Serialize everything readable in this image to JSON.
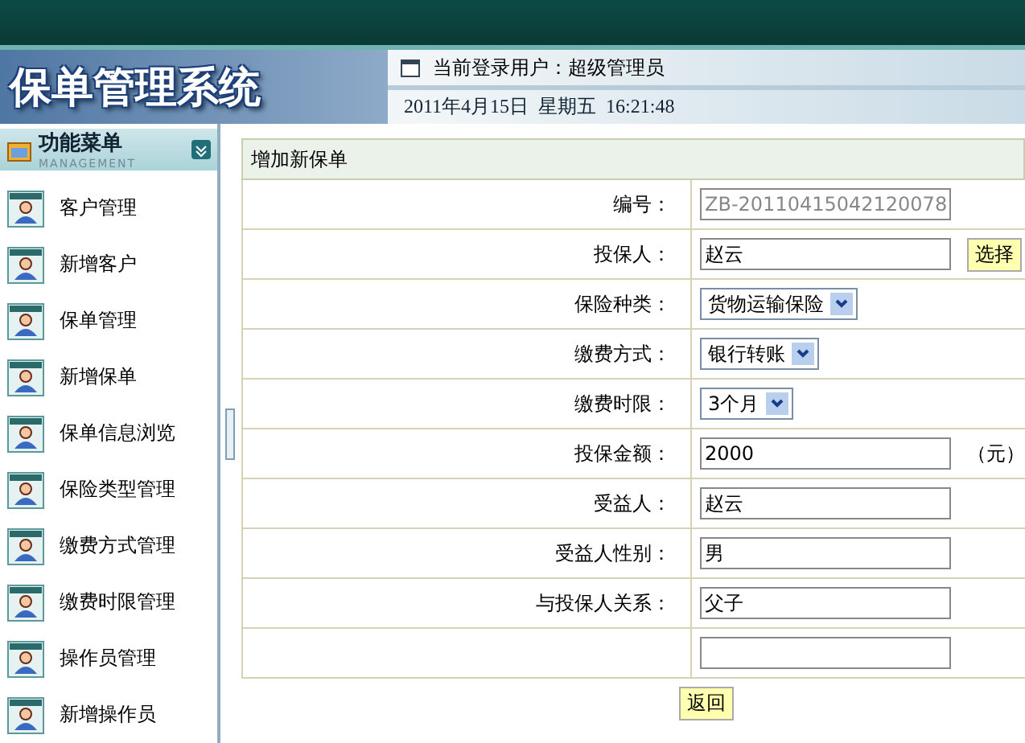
{
  "header": {
    "title": "保单管理系统",
    "user_label": "当前登录用户：超级管理员",
    "datetime": "2011年4月15日  星期五  16:21:48"
  },
  "sidebar": {
    "title": "功能菜单",
    "subtitle": "MANAGEMENT",
    "items": [
      {
        "label": "客户管理"
      },
      {
        "label": "新增客户"
      },
      {
        "label": "保单管理"
      },
      {
        "label": "新增保单"
      },
      {
        "label": "保单信息浏览"
      },
      {
        "label": "保险类型管理"
      },
      {
        "label": "缴费方式管理"
      },
      {
        "label": "缴费时限管理"
      },
      {
        "label": "操作员管理"
      },
      {
        "label": "新增操作员"
      }
    ]
  },
  "form": {
    "title": "增加新保单",
    "rows": [
      {
        "label": "编号：",
        "kind": "readonly",
        "value": "ZB-20110415042120078"
      },
      {
        "label": "投保人：",
        "kind": "text",
        "value": "赵云",
        "button": "选择"
      },
      {
        "label": "保险种类：",
        "kind": "select",
        "value": "货物运输保险"
      },
      {
        "label": "缴费方式：",
        "kind": "select",
        "value": "银行转账"
      },
      {
        "label": "缴费时限：",
        "kind": "select",
        "value": "3个月"
      },
      {
        "label": "投保金额：",
        "kind": "text",
        "value": "2000",
        "suffix": "（元）"
      },
      {
        "label": "受益人：",
        "kind": "text",
        "value": "赵云"
      },
      {
        "label": "受益人性别：",
        "kind": "text",
        "value": "男"
      },
      {
        "label": "与投保人关系：",
        "kind": "text",
        "value": "父子"
      },
      {
        "kind": "text"
      }
    ],
    "buttons": [
      "返回"
    ]
  }
}
